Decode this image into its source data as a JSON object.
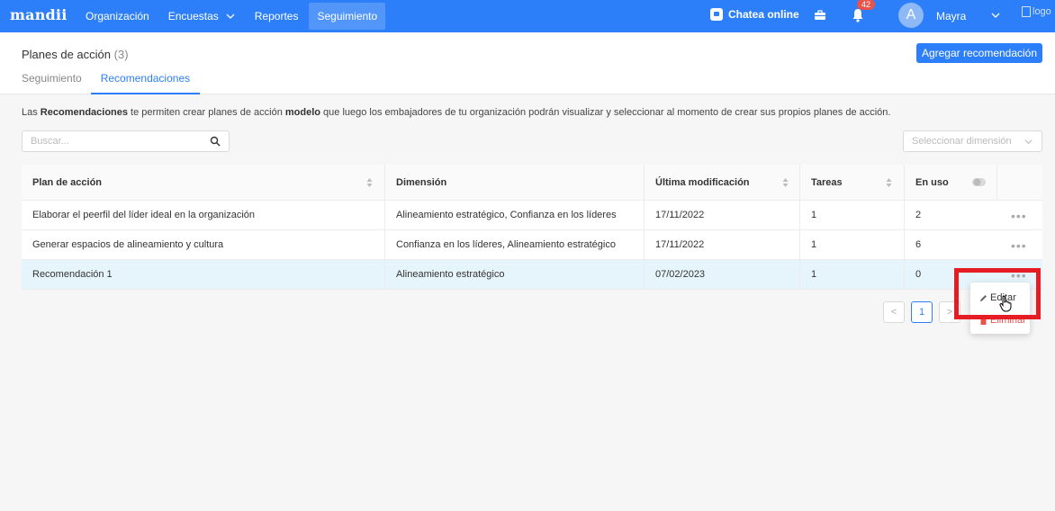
{
  "nav": {
    "logo": "mandii",
    "items": [
      {
        "label": "Organización",
        "dropdown": false,
        "active": false
      },
      {
        "label": "Encuestas",
        "dropdown": true,
        "active": false
      },
      {
        "label": "Reportes",
        "dropdown": false,
        "active": false
      },
      {
        "label": "Seguimiento",
        "dropdown": false,
        "active": true
      }
    ],
    "chat_label": "Chatea online",
    "notifications": "42",
    "avatar_letter": "A",
    "user_name": "Mayra",
    "logo_alt": "logo",
    "bg_color": "#2d7ff9"
  },
  "header": {
    "title": "Planes de acción",
    "count": "(3)",
    "add_button": "Agregar recomendación",
    "tabs": [
      {
        "label": "Seguimiento",
        "active": false
      },
      {
        "label": "Recomendaciones",
        "active": true
      }
    ]
  },
  "description": {
    "p1": "Las ",
    "b1": "Recomendaciones",
    "p2": " te permiten crear planes de acción ",
    "b2": "modelo",
    "p3": " que luego los embajadores de tu organización podrán visualizar y seleccionar al momento de crear sus propios planes de acción."
  },
  "search": {
    "placeholder": "Buscar..."
  },
  "dimension_select": {
    "placeholder": "Seleccionar dimensión"
  },
  "table": {
    "headers": [
      "Plan de acción",
      "Dimensión",
      "Última modificación",
      "Tareas",
      "En uso"
    ],
    "rows": [
      {
        "plan": "Elaborar el peerfil del líder ideal en la organización",
        "dimension": "Alineamiento estratégico, Confianza en los líderes",
        "modified": "17/11/2022",
        "tasks": "1",
        "in_use": "2"
      },
      {
        "plan": "Generar espacios de alineamiento y cultura",
        "dimension": "Confianza en los líderes, Alineamiento estratégico",
        "modified": "17/11/2022",
        "tasks": "1",
        "in_use": "6"
      },
      {
        "plan": "Recomendación 1",
        "dimension": "Alineamiento estratégico",
        "modified": "07/02/2023",
        "tasks": "1",
        "in_use": "0"
      }
    ],
    "more_label": "•••"
  },
  "pagination": {
    "prev": "<",
    "current": "1",
    "next": ">"
  },
  "menu": {
    "edit": "Editar",
    "delete": "Eliminar"
  }
}
